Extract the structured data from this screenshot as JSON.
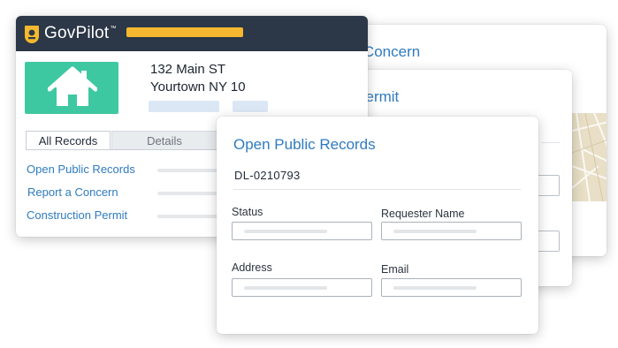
{
  "app": {
    "brand": "GovPilot",
    "brand_mark": "™",
    "colors": {
      "topbar": "#2c3747",
      "accent_yellow": "#f5b82e",
      "house_tile": "#3ec8a1",
      "link_blue": "#2f7bbf"
    }
  },
  "property": {
    "address_line1": "132 Main ST",
    "address_line2": "Yourtown NY 10",
    "icon": "house-icon"
  },
  "tabs": [
    {
      "label": "All Records",
      "active": true
    },
    {
      "label": "Details",
      "active": false
    }
  ],
  "records_list": [
    {
      "label": "Open Public Records"
    },
    {
      "label": "Report a Concern"
    },
    {
      "label": "Construction Permit"
    }
  ],
  "cards": {
    "report": {
      "title": "Report a Concern"
    },
    "construction": {
      "title": "Construction Permit"
    },
    "open_records": {
      "title": "Open Public Records",
      "record_id": "DL-0210793",
      "fields": {
        "status": {
          "label": "Status",
          "value": ""
        },
        "requester_name": {
          "label": "Requester Name",
          "value": ""
        },
        "address": {
          "label": "Address",
          "value": ""
        },
        "email": {
          "label": "Email",
          "value": ""
        }
      }
    }
  }
}
